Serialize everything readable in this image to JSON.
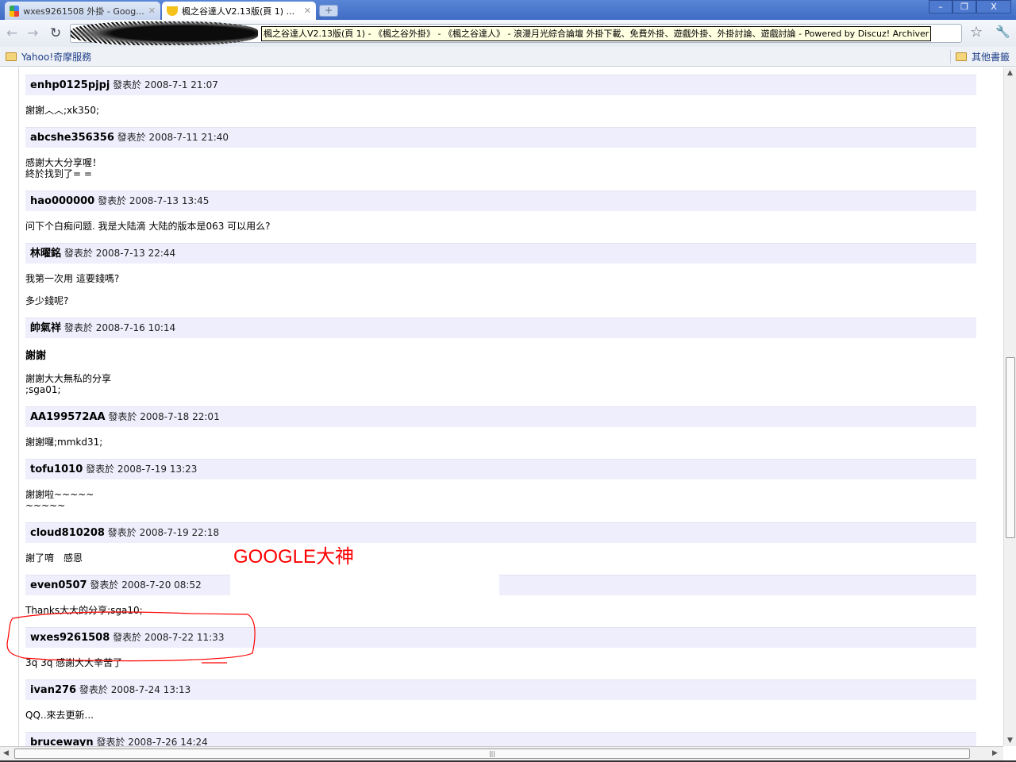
{
  "browser": {
    "tabs": [
      {
        "label": "wxes9261508 外掛 - Goog...",
        "icon": "google-icon"
      },
      {
        "label": "楓之谷達人V2.13版(頁 1) ...",
        "icon": "forum-icon"
      }
    ],
    "tooltip": "楓之谷達人V2.13版(頁 1) - 《楓之谷外掛》 - 《楓之谷達人》 - 浪漫月光綜合論壇 外掛下載、免費外掛、遊戲外掛、外掛討論、遊戲討論 - Powered by Discuz! Archiver",
    "bookmark": "Yahoo!奇摩服務",
    "other_bookmarks": "其他書籤"
  },
  "posted_label": "發表於",
  "posts": [
    {
      "user": "enhp0125pjpj",
      "time": "2008-7-1 21:07",
      "lines": [
        "謝謝︿︿;xk350;"
      ]
    },
    {
      "user": "abcshe356356",
      "time": "2008-7-11 21:40",
      "lines": [
        "感謝大大分享喔！\n終於找到了= ="
      ]
    },
    {
      "user": "hao000000",
      "time": "2008-7-13 13:45",
      "lines": [
        "问下个白痴问题. 我是大陆滴 大陆的版本是063 可以用么?"
      ]
    },
    {
      "user": "林曜銘",
      "time": "2008-7-13 22:44",
      "lines": [
        "我第一次用 這要錢嗎?",
        "多少錢呢?"
      ]
    },
    {
      "user": "帥氣祥",
      "time": "2008-7-16 10:14",
      "heading": "謝謝",
      "lines": [
        "謝謝大大無私的分享\n;sga01;"
      ]
    },
    {
      "user": "AA199572AA",
      "time": "2008-7-18 22:01",
      "lines": [
        "謝謝囉;mmkd31;"
      ]
    },
    {
      "user": "tofu1010",
      "time": "2008-7-19 13:23",
      "lines": [
        "謝謝啦~~~~~\n~~~~~"
      ]
    },
    {
      "user": "cloud810208",
      "time": "2008-7-19 22:18",
      "lines": [
        "謝了唷　感恩"
      ]
    },
    {
      "user": "even0507",
      "time": "2008-7-20 08:52",
      "lines": [
        "Thanks大大的分享;sga10;"
      ]
    },
    {
      "user": "wxes9261508",
      "time": "2008-7-22 11:33",
      "lines": [
        "3q 3q  感謝大大辛苦了"
      ]
    },
    {
      "user": "ivan276",
      "time": "2008-7-24 13:13",
      "lines": [
        "QQ..來去更新..."
      ]
    },
    {
      "user": "brucewayn",
      "time": "2008-7-26 14:24",
      "lines": []
    }
  ],
  "annotation": {
    "text": "GOOGLE大神",
    "color": "#ff0000"
  }
}
